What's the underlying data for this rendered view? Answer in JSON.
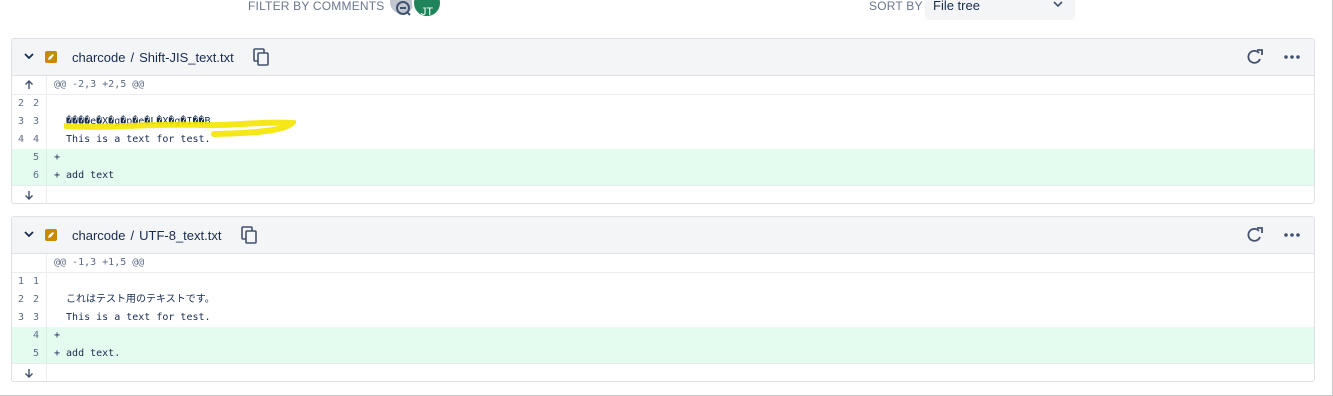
{
  "filter": {
    "label": "FILTER BY COMMENTS",
    "user_initials": "JT"
  },
  "sort": {
    "label": "SORT BY",
    "selected": "File tree"
  },
  "files": [
    {
      "folder": "charcode",
      "separator": "/",
      "filename": "Shift-JIS_text.txt",
      "hunk": "@@ -2,3 +2,5 @@",
      "lines": [
        {
          "old": "2",
          "new": "2",
          "text": ""
        },
        {
          "old": "3",
          "new": "3",
          "text": "  ����e�X�g�p�e�L�X�g�I��B"
        },
        {
          "old": "4",
          "new": "4",
          "text": "  This is a text for test."
        },
        {
          "old": "",
          "new": "5",
          "text": "+"
        },
        {
          "old": "",
          "new": "6",
          "text": "+ add text"
        }
      ]
    },
    {
      "folder": "charcode",
      "separator": "/",
      "filename": "UTF-8_text.txt",
      "hunk": "@@ -1,3 +1,5 @@",
      "lines": [
        {
          "old": "1",
          "new": "1",
          "text": ""
        },
        {
          "old": "2",
          "new": "2",
          "text": "  これはテスト用のテキストです。"
        },
        {
          "old": "3",
          "new": "3",
          "text": "  This is a text for test."
        },
        {
          "old": "",
          "new": "4",
          "text": "+"
        },
        {
          "old": "",
          "new": "5",
          "text": "+ add text."
        }
      ]
    }
  ],
  "colors": {
    "added_bg": "#e3fcef",
    "highlight": "#f5e400",
    "file_icon": "#c78a00",
    "avatar": "#1f845a"
  },
  "icons": [
    "comment-icon",
    "chevron-down-icon",
    "edit-icon",
    "copy-icon",
    "refresh-icon",
    "more-icon",
    "arrow-up-icon",
    "arrow-down-icon"
  ]
}
